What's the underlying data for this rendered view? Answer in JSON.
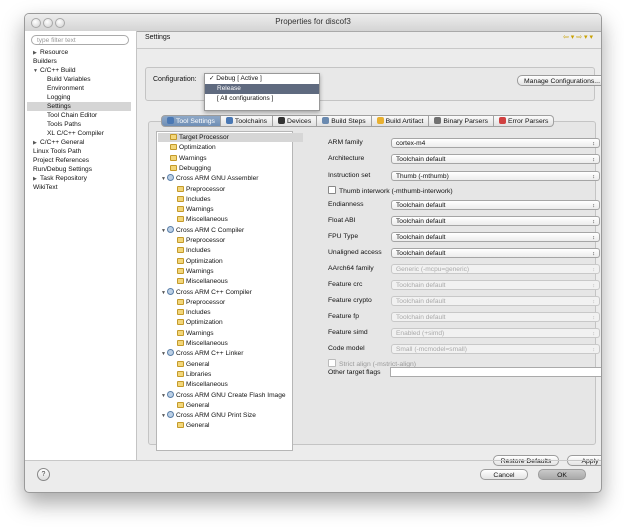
{
  "window": {
    "title": "Properties for discof3"
  },
  "sidebar": {
    "filter_placeholder": "type filter text",
    "items": [
      {
        "label": "Resource",
        "expand": "▶",
        "indent": 0
      },
      {
        "label": "Builders",
        "expand": "",
        "indent": 0
      },
      {
        "label": "C/C++ Build",
        "expand": "▼",
        "indent": 0
      },
      {
        "label": "Build Variables",
        "expand": "",
        "indent": 1
      },
      {
        "label": "Environment",
        "expand": "",
        "indent": 1
      },
      {
        "label": "Logging",
        "expand": "",
        "indent": 1
      },
      {
        "label": "Settings",
        "expand": "",
        "indent": 1,
        "selected": true
      },
      {
        "label": "Tool Chain Editor",
        "expand": "",
        "indent": 1
      },
      {
        "label": "Tools Paths",
        "expand": "",
        "indent": 1
      },
      {
        "label": "XL C/C++ Compiler",
        "expand": "",
        "indent": 1
      },
      {
        "label": "C/C++ General",
        "expand": "▶",
        "indent": 0
      },
      {
        "label": "Linux Tools Path",
        "expand": "",
        "indent": 0
      },
      {
        "label": "Project References",
        "expand": "",
        "indent": 0
      },
      {
        "label": "Run/Debug Settings",
        "expand": "",
        "indent": 0
      },
      {
        "label": "Task Repository",
        "expand": "▶",
        "indent": 0
      },
      {
        "label": "WikiText",
        "expand": "",
        "indent": 0
      }
    ]
  },
  "page": {
    "title": "Settings",
    "nav_arrows": "⇦ ▾ ⇨ ▾ ▾"
  },
  "configuration": {
    "label": "Configuration:",
    "options": [
      {
        "label": "Debug  [ Active ]",
        "checked": true
      },
      {
        "label": "Release",
        "highlighted": true
      },
      {
        "label": "[ All configurations ]"
      }
    ],
    "check_mark": "✓",
    "manage_button": "Manage Configurations..."
  },
  "tabs": [
    {
      "label": "Tool Settings",
      "icon": "tool-settings-icon",
      "color": "#4a78b4",
      "active": true
    },
    {
      "label": "Toolchains",
      "icon": "toolchains-icon",
      "color": "#4a78b4"
    },
    {
      "label": "Devices",
      "icon": "devices-icon",
      "color": "#333333"
    },
    {
      "label": "Build Steps",
      "icon": "build-steps-icon",
      "color": "#6a8ab0"
    },
    {
      "label": "Build Artifact",
      "icon": "build-artifact-icon",
      "color": "#e8b030"
    },
    {
      "label": "Binary Parsers",
      "icon": "binary-parsers-icon",
      "color": "#707070"
    },
    {
      "label": "Error Parsers",
      "icon": "error-parsers-icon",
      "color": "#d04040"
    }
  ],
  "tool_tree": [
    {
      "label": "Target Processor",
      "level": 0,
      "icon": "settings-page-icon",
      "selected": true
    },
    {
      "label": "Optimization",
      "level": 0,
      "icon": "settings-page-icon"
    },
    {
      "label": "Warnings",
      "level": 0,
      "icon": "settings-page-icon"
    },
    {
      "label": "Debugging",
      "level": 0,
      "icon": "settings-page-icon"
    },
    {
      "label": "Cross ARM GNU Assembler",
      "level": 0,
      "icon": "tool-gear-icon",
      "expand": "▼"
    },
    {
      "label": "Preprocessor",
      "level": 1,
      "icon": "settings-page-icon"
    },
    {
      "label": "Includes",
      "level": 1,
      "icon": "settings-page-icon"
    },
    {
      "label": "Warnings",
      "level": 1,
      "icon": "settings-page-icon"
    },
    {
      "label": "Miscellaneous",
      "level": 1,
      "icon": "settings-page-icon"
    },
    {
      "label": "Cross ARM C Compiler",
      "level": 0,
      "icon": "tool-gear-icon",
      "expand": "▼"
    },
    {
      "label": "Preprocessor",
      "level": 1,
      "icon": "settings-page-icon"
    },
    {
      "label": "Includes",
      "level": 1,
      "icon": "settings-page-icon"
    },
    {
      "label": "Optimization",
      "level": 1,
      "icon": "settings-page-icon"
    },
    {
      "label": "Warnings",
      "level": 1,
      "icon": "settings-page-icon"
    },
    {
      "label": "Miscellaneous",
      "level": 1,
      "icon": "settings-page-icon"
    },
    {
      "label": "Cross ARM C++ Compiler",
      "level": 0,
      "icon": "tool-gear-icon",
      "expand": "▼"
    },
    {
      "label": "Preprocessor",
      "level": 1,
      "icon": "settings-page-icon"
    },
    {
      "label": "Includes",
      "level": 1,
      "icon": "settings-page-icon"
    },
    {
      "label": "Optimization",
      "level": 1,
      "icon": "settings-page-icon"
    },
    {
      "label": "Warnings",
      "level": 1,
      "icon": "settings-page-icon"
    },
    {
      "label": "Miscellaneous",
      "level": 1,
      "icon": "settings-page-icon"
    },
    {
      "label": "Cross ARM C++ Linker",
      "level": 0,
      "icon": "tool-gear-icon",
      "expand": "▼"
    },
    {
      "label": "General",
      "level": 1,
      "icon": "settings-page-icon"
    },
    {
      "label": "Libraries",
      "level": 1,
      "icon": "settings-page-icon"
    },
    {
      "label": "Miscellaneous",
      "level": 1,
      "icon": "settings-page-icon"
    },
    {
      "label": "Cross ARM GNU Create Flash Image",
      "level": 0,
      "icon": "tool-gear-icon",
      "expand": "▼"
    },
    {
      "label": "General",
      "level": 1,
      "icon": "settings-page-icon"
    },
    {
      "label": "Cross ARM GNU Print Size",
      "level": 0,
      "icon": "tool-gear-icon",
      "expand": "▼"
    },
    {
      "label": "General",
      "level": 1,
      "icon": "settings-page-icon"
    }
  ],
  "properties": [
    {
      "kind": "combo",
      "label": "ARM family",
      "value": "cortex-m4",
      "enabled": true
    },
    {
      "kind": "combo",
      "label": "Architecture",
      "value": "Toolchain default",
      "enabled": true
    },
    {
      "kind": "combo",
      "label": "Instruction set",
      "value": "Thumb (-mthumb)",
      "enabled": true
    },
    {
      "kind": "check",
      "label": "Thumb interwork (-mthumb-interwork)",
      "checked": false,
      "enabled": true
    },
    {
      "kind": "combo",
      "label": "Endianness",
      "value": "Toolchain default",
      "enabled": true
    },
    {
      "kind": "combo",
      "label": "Float ABI",
      "value": "Toolchain default",
      "enabled": true
    },
    {
      "kind": "combo",
      "label": "FPU Type",
      "value": "Toolchain default",
      "enabled": true
    },
    {
      "kind": "combo",
      "label": "Unaligned access",
      "value": "Toolchain default",
      "enabled": true
    },
    {
      "kind": "combo",
      "label": "AArch64 family",
      "value": "Generic (-mcpu=generic)",
      "enabled": false
    },
    {
      "kind": "combo",
      "label": "Feature crc",
      "value": "Toolchain default",
      "enabled": false
    },
    {
      "kind": "combo",
      "label": "Feature crypto",
      "value": "Toolchain default",
      "enabled": false
    },
    {
      "kind": "combo",
      "label": "Feature fp",
      "value": "Toolchain default",
      "enabled": false
    },
    {
      "kind": "combo",
      "label": "Feature simd",
      "value": "Enabled (+simd)",
      "enabled": false
    },
    {
      "kind": "combo",
      "label": "Code model",
      "value": "Small (-mcmodel=small)",
      "enabled": false
    },
    {
      "kind": "check",
      "label": "Strict align (-mstrict-align)",
      "checked": false,
      "enabled": false
    },
    {
      "kind": "text",
      "label": "Other target flags",
      "value": ""
    }
  ],
  "buttons": {
    "restore_defaults": "Restore Defaults",
    "apply": "Apply",
    "cancel": "Cancel",
    "ok": "OK",
    "help": "?"
  }
}
